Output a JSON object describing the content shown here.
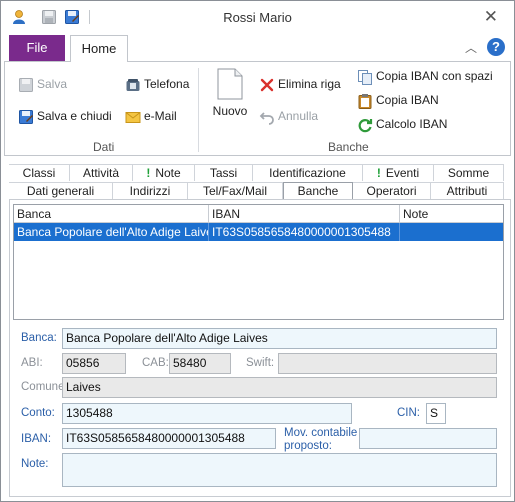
{
  "window": {
    "title": "Rossi Mario"
  },
  "ribbon": {
    "file_tab": "File",
    "home_tab": "Home",
    "dati": {
      "label": "Dati",
      "salva": "Salva",
      "salva_chiudi": "Salva e chiudi",
      "telefona": "Telefona",
      "email": "e-Mail"
    },
    "banche": {
      "label": "Banche",
      "nuovo": "Nuovo",
      "elimina_riga": "Elimina riga",
      "annulla": "Annulla",
      "copia_iban_spazi": "Copia IBAN con spazi",
      "copia_iban": "Copia IBAN",
      "calcolo_iban": "Calcolo IBAN"
    }
  },
  "tabs_row1": [
    {
      "label": "Classi"
    },
    {
      "label": "Attività"
    },
    {
      "label": "Note"
    },
    {
      "label": "Tassi"
    },
    {
      "label": "Identificazione"
    },
    {
      "label": "Eventi"
    },
    {
      "label": "Somme"
    }
  ],
  "tabs_row2": [
    {
      "label": "Dati generali"
    },
    {
      "label": "Indirizzi"
    },
    {
      "label": "Tel/Fax/Mail"
    },
    {
      "label": "Banche"
    },
    {
      "label": "Operatori"
    },
    {
      "label": "Attributi"
    }
  ],
  "grid": {
    "columns": [
      "Banca",
      "IBAN",
      "Note"
    ],
    "rows": [
      {
        "banca": "Banca Popolare dell'Alto Adige Laives",
        "iban": "IT63S0585658480000001305488",
        "note": ""
      }
    ]
  },
  "form": {
    "banca_label": "Banca:",
    "banca": "Banca Popolare dell'Alto Adige Laives",
    "abi_label": "ABI:",
    "abi": "05856",
    "cab_label": "CAB:",
    "cab": "58480",
    "swift_label": "Swift:",
    "swift": "",
    "comune_label": "Comune:",
    "comune": "Laives",
    "conto_label": "Conto:",
    "conto": "1305488",
    "cin_label": "CIN:",
    "cin": "S",
    "iban_label": "IBAN:",
    "iban": "IT63S0585658480000001305488",
    "mov_label_1": "Mov. contabile",
    "mov_label_2": "proposto:",
    "mov": "",
    "note_label": "Note:",
    "note": ""
  }
}
